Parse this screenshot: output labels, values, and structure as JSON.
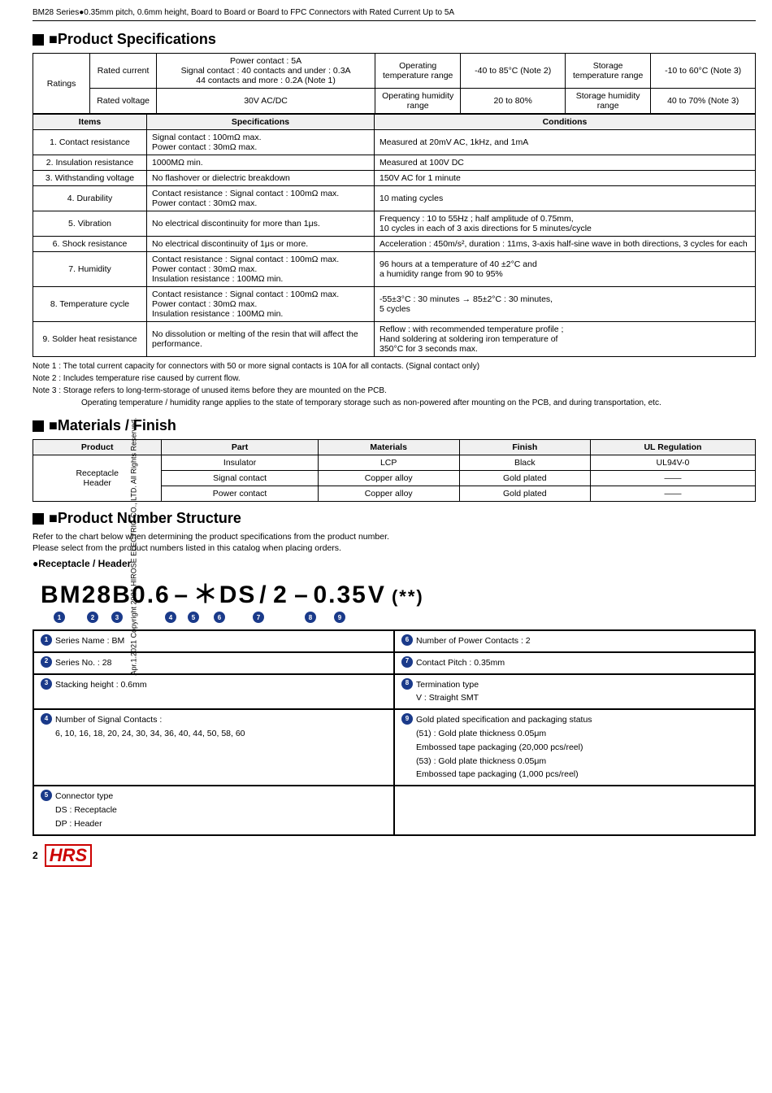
{
  "page": {
    "header": "BM28 Series●0.35mm pitch, 0.6mm height, Board to Board or Board to FPC Connectors with Rated Current Up to 5A",
    "sidebar": "Apr.1.2021 Copyright 2021 HIROSE ELECTRIC CO., LTD. All Rights Reserved.",
    "footer_num": "2"
  },
  "product_specs": {
    "title": "■Product Specifications",
    "ratings": {
      "rated_current_label": "Rated current",
      "rated_current_value1": "Power contact : 5A",
      "rated_current_value2": "Signal contact : 40 contacts and under : 0.3A",
      "rated_current_value3": "44 contacts and more  : 0.2A (Note 1)",
      "op_temp_label": "Operating temperature range",
      "op_temp_value": "-40 to 85°C (Note 2)",
      "storage_temp_label": "Storage temperature range",
      "storage_temp_value": "-10 to 60°C (Note 3)",
      "rated_voltage_label": "Rated voltage",
      "rated_voltage_value": "30V AC/DC",
      "op_humidity_label": "Operating humidity range",
      "op_humidity_value": "20 to 80%",
      "storage_humidity_label": "Storage humidity range",
      "storage_humidity_value": "40 to 70% (Note 3)"
    },
    "table_headers": {
      "items": "Items",
      "specifications": "Specifications",
      "conditions": "Conditions"
    },
    "rows": [
      {
        "item": "1. Contact resistance",
        "spec": "Signal contact : 100mΩ max.\nPower contact : 30mΩ max.",
        "condition": "Measured at 20mV AC, 1kHz, and 1mA"
      },
      {
        "item": "2. Insulation resistance",
        "spec": "1000MΩ min.",
        "condition": "Measured at 100V DC"
      },
      {
        "item": "3. Withstanding voltage",
        "spec": "No flashover or dielectric breakdown",
        "condition": "150V AC for 1 minute"
      },
      {
        "item": "4. Durability",
        "spec": "Contact resistance : Signal contact : 100mΩ max.\nPower contact : 30mΩ max.",
        "condition": "10 mating cycles"
      },
      {
        "item": "5. Vibration",
        "spec": "No electrical discontinuity for more than 1μs.",
        "condition": "Frequency : 10 to 55Hz ; half amplitude of 0.75mm,\n10 cycles in each of 3 axis directions for 5 minutes/cycle"
      },
      {
        "item": "6. Shock resistance",
        "spec": "No electrical discontinuity of 1μs or more.",
        "condition": "Acceleration : 450m/s², duration : 11ms, 3-axis half-sine wave in both directions, 3 cycles for each"
      },
      {
        "item": "7. Humidity",
        "spec": "Contact resistance : Signal contact : 100mΩ max.\nPower contact : 30mΩ max.\nInsulation resistance : 100MΩ min.",
        "condition": "96 hours at a temperature of 40 ±2°C and\na humidity range from 90 to 95%"
      },
      {
        "item": "8. Temperature cycle",
        "spec": "Contact resistance : Signal contact : 100mΩ max.\nPower contact : 30mΩ max.\nInsulation resistance : 100MΩ min.",
        "condition": "-55±3°C : 30 minutes → 85±2°C : 30 minutes,\n5 cycles"
      },
      {
        "item": "9. Solder heat resistance",
        "spec": "No dissolution or melting of the resin that will affect the performance.",
        "condition": "Reflow : with recommended temperature profile ;\nHand soldering at soldering iron temperature of\n350°C for 3 seconds max."
      }
    ],
    "notes": [
      "Note 1 : The total current capacity for connectors with 50 or more signal contacts is 10A for all contacts. (Signal contact only)",
      "Note 2 : Includes temperature rise caused by current flow.",
      "Note 3 : Storage refers to long-term-storage of unused items before they are mounted on the PCB.",
      "Operating temperature / humidity range applies to the state of temporary storage such as non-powered after mounting on the PCB, and during transportation, etc."
    ]
  },
  "materials": {
    "title": "■Materials / Finish",
    "headers": [
      "Product",
      "Part",
      "Materials",
      "Finish",
      "UL Regulation"
    ],
    "product": "Receptacle Header",
    "rows": [
      {
        "part": "Insulator",
        "materials": "LCP",
        "finish": "Black",
        "ul": "UL94V-0"
      },
      {
        "part": "Signal contact",
        "materials": "Copper alloy",
        "finish": "Gold plated",
        "ul": "——"
      },
      {
        "part": "Power contact",
        "materials": "Copper alloy",
        "finish": "Gold plated",
        "ul": "——"
      }
    ]
  },
  "product_number": {
    "title": "■Product Number Structure",
    "desc1": "Refer to the chart below when determining the product specifications from the product number.",
    "desc2": "Please select from the product numbers listed in this catalog when placing orders.",
    "receptacle_label": "●Receptacle / Header",
    "number_parts": [
      "BM",
      "28",
      "B",
      "0.6",
      "–",
      "＊",
      "DS",
      "/",
      "2",
      "–",
      "0.35",
      "V",
      "(**)"
    ],
    "circle_positions": [
      "❶",
      "❷",
      "❸",
      "",
      "❹",
      "❺",
      "❻",
      "",
      "❼",
      "",
      "❽",
      "❾",
      ""
    ],
    "descriptions_left": [
      {
        "num": "❶",
        "text": "Series Name : BM"
      },
      {
        "num": "❷",
        "text": "Series No. : 28"
      },
      {
        "num": "❸",
        "text": "Stacking height : 0.6mm"
      },
      {
        "num": "❹",
        "text": "Number of Signal Contacts :\n6, 10, 16, 18, 20, 24, 30, 34, 36, 40, 44, 50, 58, 60"
      },
      {
        "num": "❺",
        "text": "Connector type\nDS : Receptacle\nDP : Header"
      }
    ],
    "descriptions_right": [
      {
        "num": "❻",
        "text": "Number of Power Contacts : 2"
      },
      {
        "num": "❼",
        "text": "Contact Pitch : 0.35mm"
      },
      {
        "num": "❽",
        "text": "Termination type\nV : Straight SMT"
      },
      {
        "num": "❾",
        "text": "Gold plated specification and packaging status\n(51) : Gold plate thickness 0.05μm\nEmbossed tape packaging (20,000 pcs/reel)\n(53) : Gold plate thickness 0.05μm\nEmbossed tape packaging (1,000 pcs/reel)"
      }
    ]
  }
}
